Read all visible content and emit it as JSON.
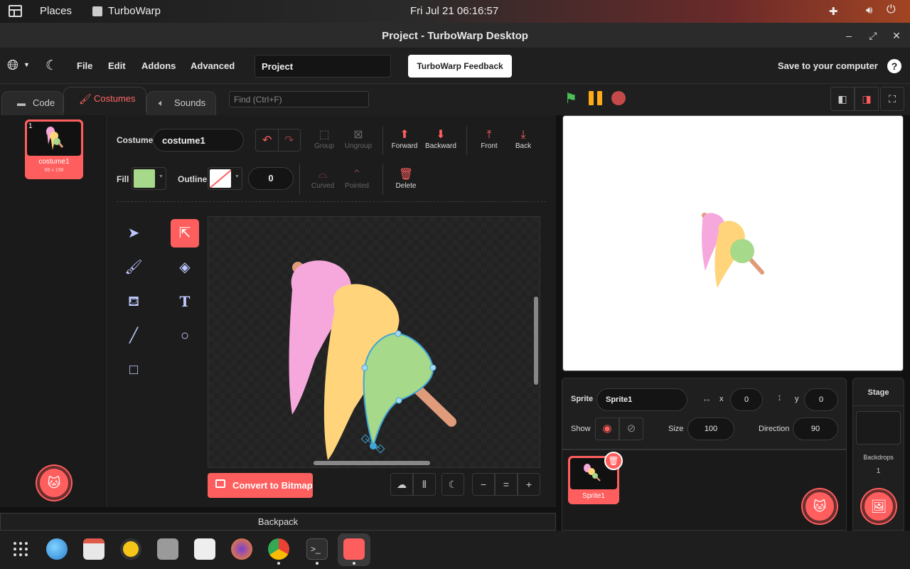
{
  "system": {
    "places": "Places",
    "app_name": "TurboWarp",
    "clock": "Fri Jul 21  06:16:57"
  },
  "window": {
    "title": "Project - TurboWarp Desktop",
    "minimize": "–",
    "maximize": "⤢",
    "close": "✕"
  },
  "menu": {
    "file": "File",
    "edit": "Edit",
    "addons": "Addons",
    "advanced": "Advanced",
    "project_name": "Project",
    "feedback": "TurboWarp Feedback",
    "save": "Save to your computer",
    "help": "?"
  },
  "tabs": {
    "code": "Code",
    "costumes": "Costumes",
    "sounds": "Sounds",
    "find_placeholder": "Find (Ctrl+F)"
  },
  "costume_list": [
    {
      "number": "1",
      "name": "costume1",
      "size": "88 x 198"
    }
  ],
  "editor": {
    "costume_label": "Costume",
    "costume_name": "costume1",
    "group": "Group",
    "ungroup": "Ungroup",
    "forward": "Forward",
    "backward": "Backward",
    "front": "Front",
    "back": "Back",
    "fill_label": "Fill",
    "outline_label": "Outline",
    "outline_width": "0",
    "curved": "Curved",
    "pointed": "Pointed",
    "delete": "Delete",
    "convert": "Convert to Bitmap",
    "fill_color": "#a6d98a",
    "zoom_in": "+",
    "zoom_reset": "=",
    "zoom_out": "−"
  },
  "sprite": {
    "sprite_label": "Sprite",
    "sprite_name": "Sprite1",
    "x_label": "x",
    "x": "0",
    "y_label": "y",
    "y": "0",
    "show_label": "Show",
    "size_label": "Size",
    "size": "100",
    "direction_label": "Direction",
    "direction": "90",
    "sprites": [
      {
        "name": "Sprite1"
      }
    ]
  },
  "stage_panel": {
    "title": "Stage",
    "backdrops_label": "Backdrops",
    "backdrops_count": "1"
  },
  "backpack": "Backpack",
  "colors": {
    "accent": "#ff5e5e",
    "pink": "#f6a8dc",
    "yellow": "#ffd47a",
    "green": "#a6d98a",
    "stick": "#e09c7a"
  }
}
